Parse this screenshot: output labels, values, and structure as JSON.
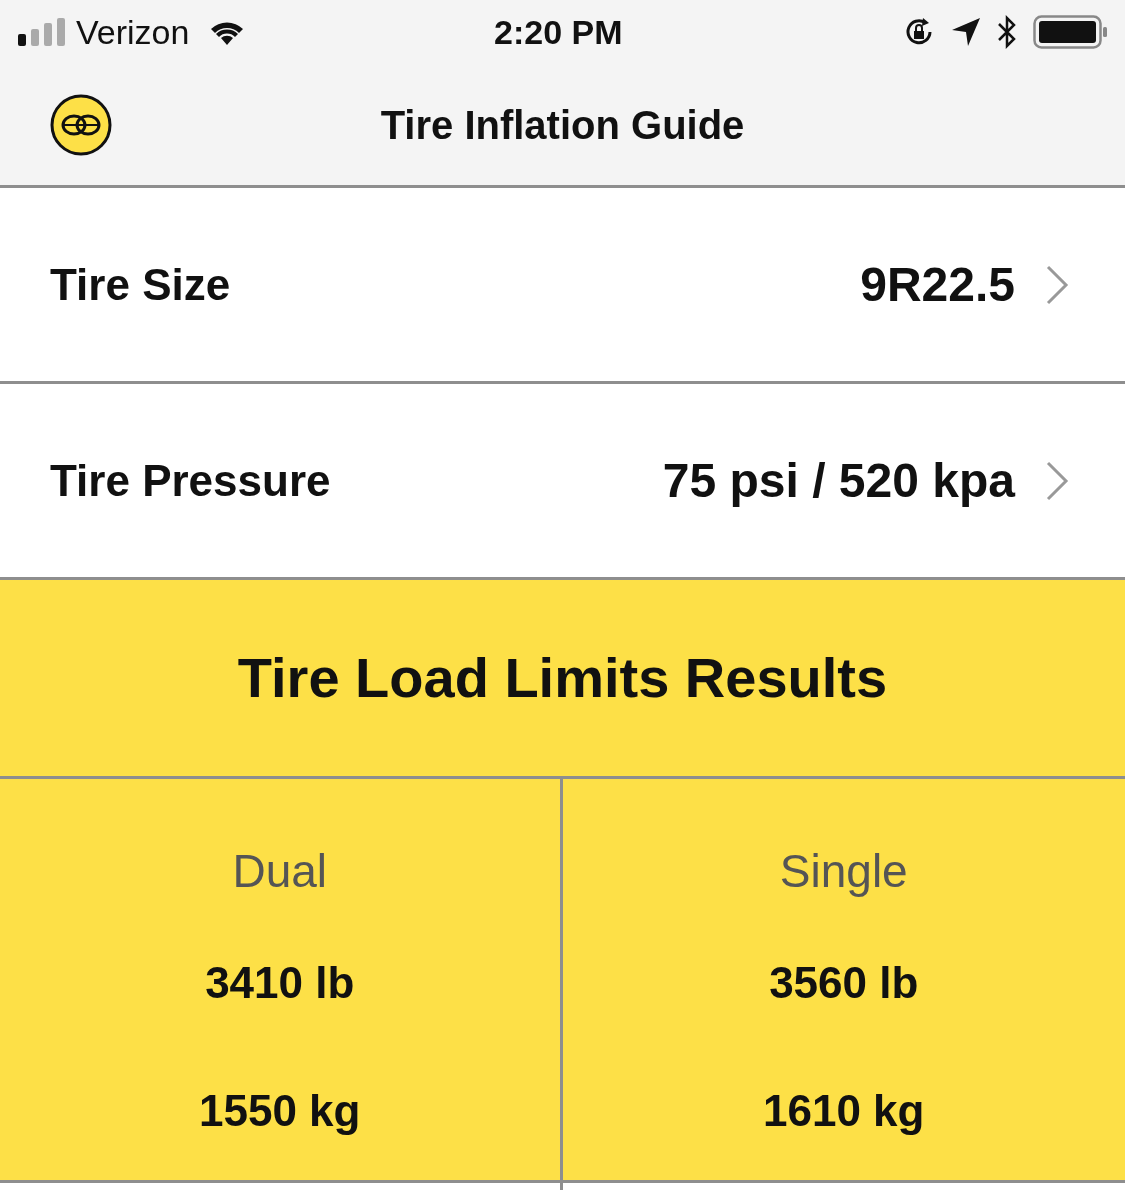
{
  "status_bar": {
    "carrier": "Verizon",
    "time": "2:20 PM"
  },
  "navigation_bar": {
    "title": "Tire Inflation Guide"
  },
  "settings_rows": [
    {
      "label": "Tire Size",
      "value": "9R22.5"
    },
    {
      "label": "Tire Pressure",
      "value": "75 psi / 520 kpa"
    }
  ],
  "results": {
    "title": "Tire Load Limits Results",
    "columns": [
      {
        "heading": "Dual",
        "values": [
          "3410 lb",
          "1550 kg"
        ]
      },
      {
        "heading": "Single",
        "values": [
          "3560 lb",
          "1610 kg"
        ]
      }
    ]
  }
}
